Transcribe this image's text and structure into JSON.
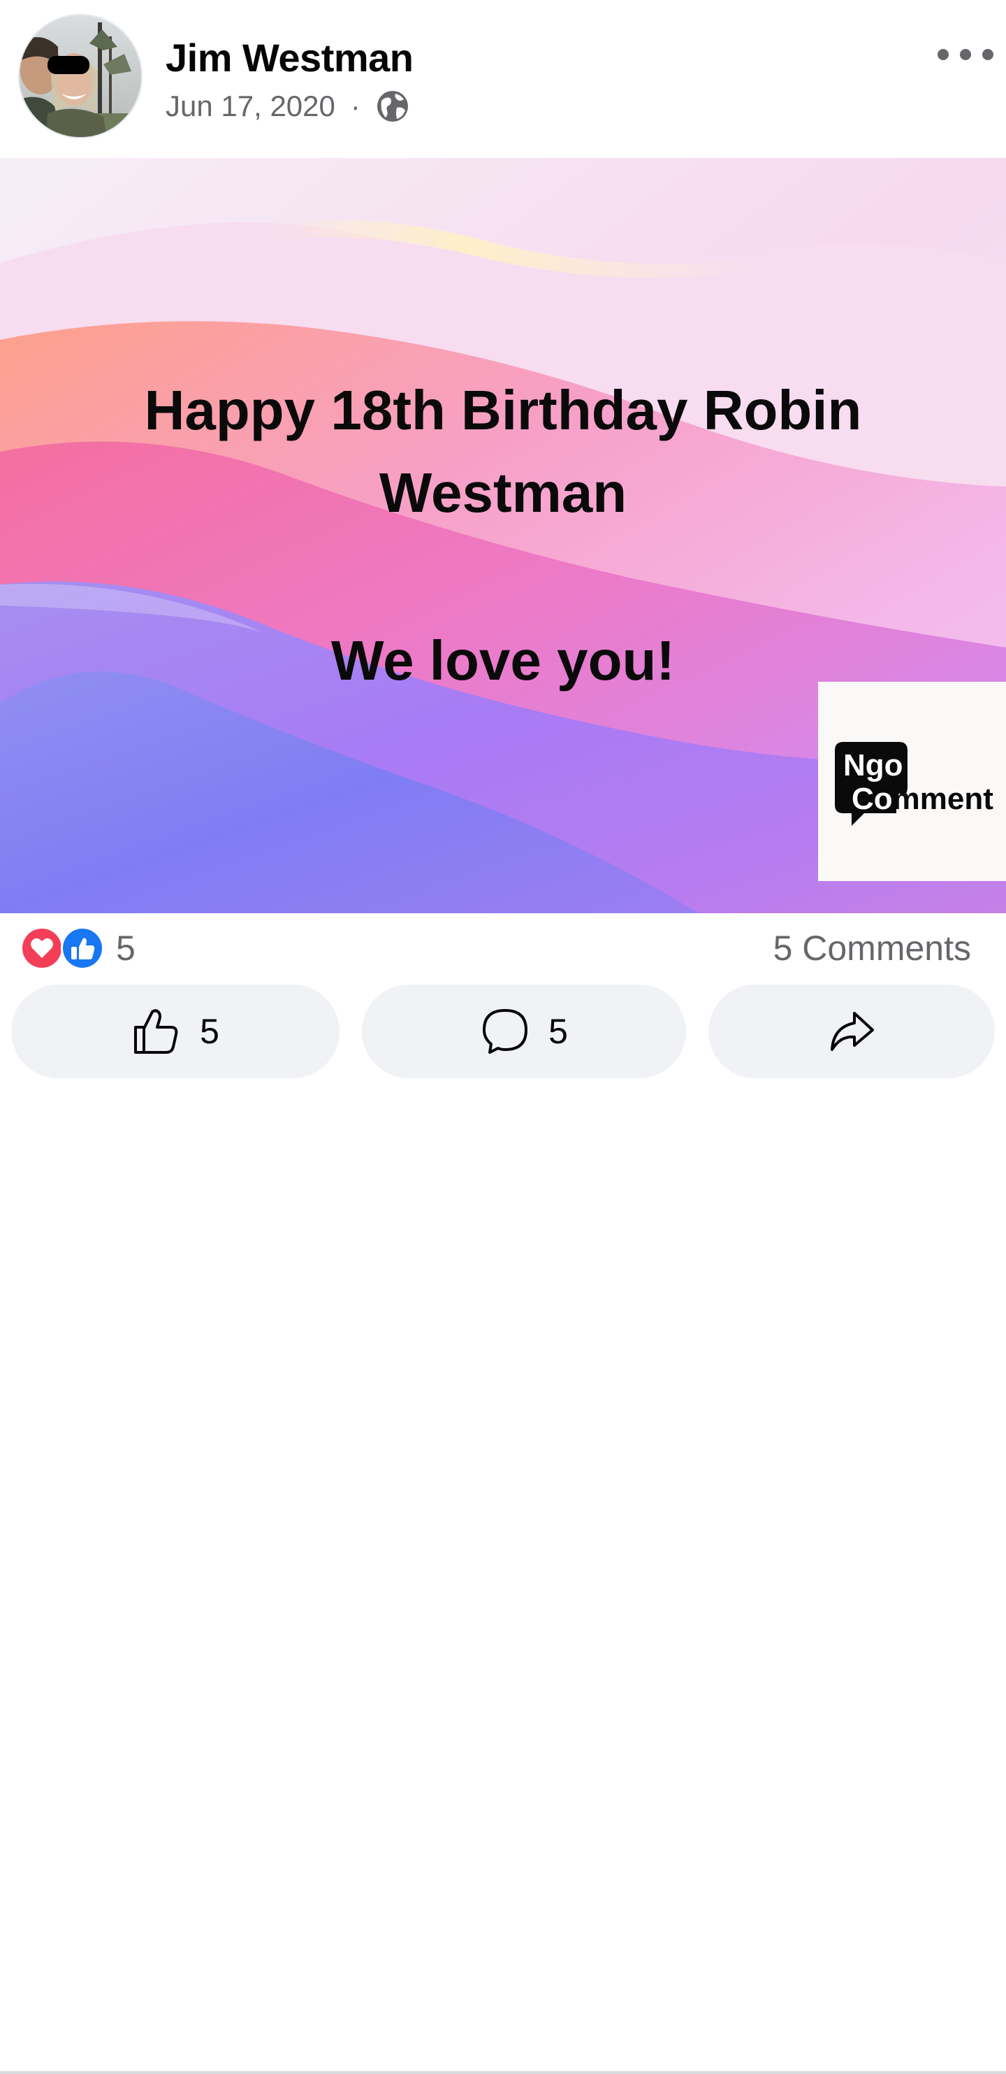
{
  "post": {
    "author": "Jim Westman",
    "date": "Jun 17, 2020",
    "separator": "·",
    "audience_icon": "globe-icon",
    "more_icon": "more-options-icon"
  },
  "image": {
    "line1": "Happy 18th Birthday Robin",
    "line2": "Westman",
    "line3": "We love you!",
    "watermark": {
      "logo_line1": "Ngo",
      "logo_line2": "Comment"
    },
    "colors": {
      "top": "#f3ecf8",
      "pink": "#f27fb1",
      "magenta": "#e87ed6",
      "purple": "#a97af2",
      "blue": "#7c78f1"
    }
  },
  "reactions": {
    "count": "5",
    "comments_label": "5 Comments",
    "icons": [
      "love-reaction-icon",
      "like-reaction-icon"
    ],
    "colors": {
      "love": "#f33e58",
      "like": "#1877f2"
    }
  },
  "actions": {
    "like_count": "5",
    "comment_count": "5",
    "icons": [
      "thumbs-up-icon",
      "comment-bubble-icon",
      "share-arrow-icon"
    ]
  }
}
